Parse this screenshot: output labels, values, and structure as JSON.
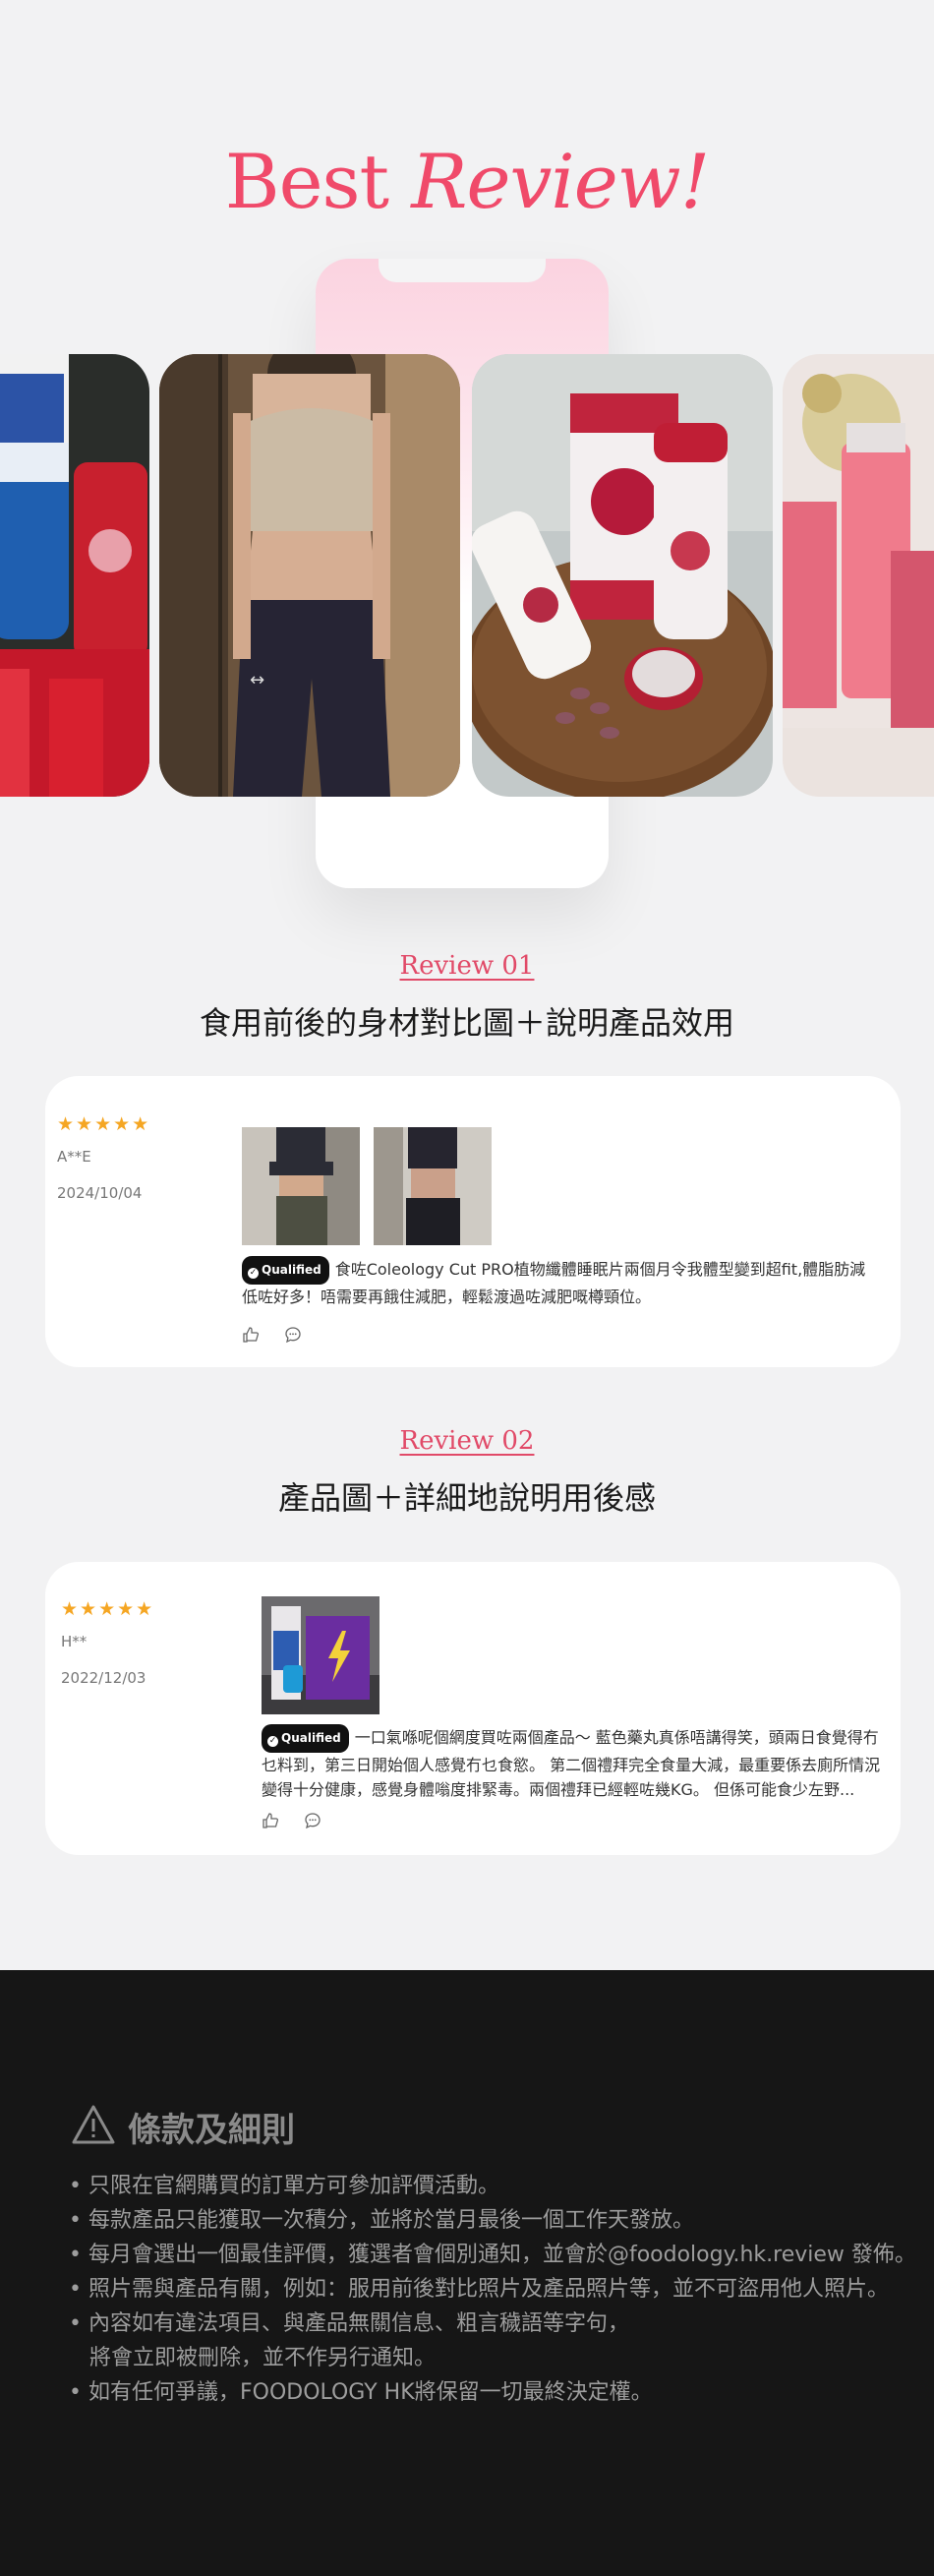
{
  "header": {
    "title_part1": "Best ",
    "title_part2": "Review!"
  },
  "reviews": [
    {
      "label": "Review 01",
      "heading": "食用前後的身材對比圖＋說明產品效用",
      "stars": "★★★★★",
      "user": "A**E",
      "date": "2024/10/04",
      "badge": "Qualified",
      "text": "食咗Coleology Cut PRO植物纖體睡眠片兩個月令我體型變到超fit,體脂肪減低咗好多！唔需要再餓住減肥，輕鬆渡過咗減肥嘅樽頸位。"
    },
    {
      "label": "Review 02",
      "heading": "產品圖＋詳細地說明用後感",
      "stars": "★★★★★",
      "user": "H**",
      "date": "2022/12/03",
      "badge": "Qualified",
      "text": "一口氣喺呢個網度買咗兩個產品～ 藍色藥丸真係唔講得笑，頭兩日食覺得冇乜料到，第三日開始個人感覺冇乜食慾。 第二個禮拜完全食量大減，最重要係去廁所情況變得十分健康，感覺身體嗡度排緊毒。兩個禮拜已經輕咗幾KG。 但係可能食少左野..."
    }
  ],
  "terms": {
    "title": "條款及細則",
    "items": [
      "• 只限在官網購買的訂單方可參加評價活動。",
      "• 每款產品只能獲取一次積分，並將於當月最後一個工作天發放。",
      "• 每月會選出一個最佳評價，獲選者會個別通知，並會於@foodology.hk.review 發佈。",
      "• 照片需與產品有關，例如：服用前後對比照片及產品照片等，並不可盜用他人照片。",
      "• 內容如有違法項目、與產品無關信息、粗言穢語等字句，",
      "   將會立即被刪除，並不作另行通知。",
      "• 如有任何爭議，FOODOLOGY HK將保留一切最終決定權。"
    ]
  },
  "icons": {
    "like": "thumbs-up-icon",
    "comment": "comment-icon",
    "warning": "warning-icon",
    "star": "star-icon"
  },
  "colors": {
    "accent": "#f04a6a",
    "stars": "#f5a623",
    "footer_bg": "#161616"
  }
}
